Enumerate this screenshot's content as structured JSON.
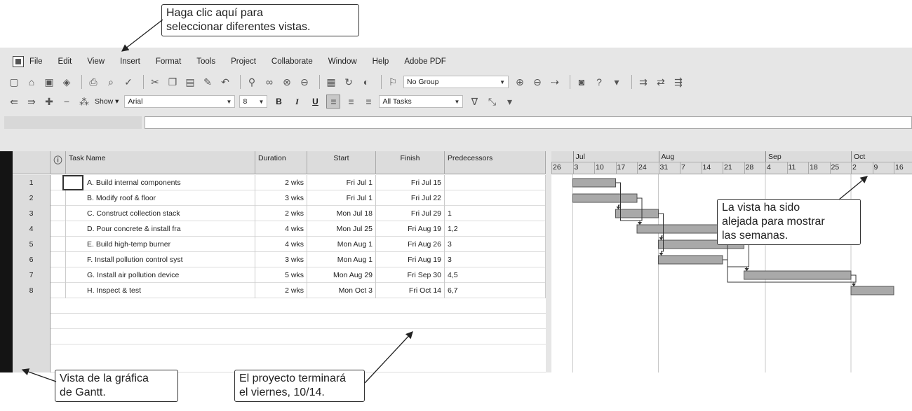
{
  "menubar": {
    "items": [
      "File",
      "Edit",
      "View",
      "Insert",
      "Format",
      "Tools",
      "Project",
      "Collaborate",
      "Window",
      "Help",
      "Adobe PDF"
    ]
  },
  "toolbar": {
    "group_value": "No Group",
    "show_label": "Show",
    "font_value": "Arial",
    "size_value": "8",
    "bold": "B",
    "italic": "I",
    "underline": "U",
    "filter_value": "All Tasks"
  },
  "table": {
    "columns": [
      "Task Name",
      "Duration",
      "Start",
      "Finish",
      "Predecessors"
    ],
    "rows": [
      {
        "id": "1",
        "name": "A. Build internal components",
        "duration": "2 wks",
        "start": "Fri Jul 1",
        "finish": "Fri Jul 15",
        "pred": ""
      },
      {
        "id": "2",
        "name": "B. Modify roof & floor",
        "duration": "3 wks",
        "start": "Fri Jul 1",
        "finish": "Fri Jul 22",
        "pred": ""
      },
      {
        "id": "3",
        "name": "C. Construct collection stack",
        "duration": "2 wks",
        "start": "Mon Jul 18",
        "finish": "Fri Jul 29",
        "pred": "1"
      },
      {
        "id": "4",
        "name": "D. Pour concrete & install fra",
        "duration": "4 wks",
        "start": "Mon Jul 25",
        "finish": "Fri Aug 19",
        "pred": "1,2"
      },
      {
        "id": "5",
        "name": "E. Build high-temp burner",
        "duration": "4 wks",
        "start": "Mon Aug 1",
        "finish": "Fri Aug 26",
        "pred": "3"
      },
      {
        "id": "6",
        "name": "F. Install pollution control syst",
        "duration": "3 wks",
        "start": "Mon Aug 1",
        "finish": "Fri Aug 19",
        "pred": "3"
      },
      {
        "id": "7",
        "name": "G. Install air pollution device",
        "duration": "5 wks",
        "start": "Mon Aug 29",
        "finish": "Fri Sep 30",
        "pred": "4,5"
      },
      {
        "id": "8",
        "name": "H. Inspect & test",
        "duration": "2 wks",
        "start": "Mon Oct 3",
        "finish": "Fri Oct 14",
        "pred": "6,7"
      }
    ]
  },
  "gantt": {
    "months": [
      "Jul",
      "Aug",
      "Sep",
      "Oct"
    ],
    "weeks": [
      "26",
      "3",
      "10",
      "17",
      "24",
      "31",
      "7",
      "14",
      "21",
      "28",
      "4",
      "11",
      "18",
      "25",
      "2",
      "9",
      "16"
    ],
    "tasks": [
      {
        "start_week": 1.0,
        "end_week": 3.0
      },
      {
        "start_week": 1.0,
        "end_week": 4.0
      },
      {
        "start_week": 3.0,
        "end_week": 5.0
      },
      {
        "start_week": 4.0,
        "end_week": 8.0
      },
      {
        "start_week": 5.0,
        "end_week": 9.0
      },
      {
        "start_week": 5.0,
        "end_week": 8.0
      },
      {
        "start_week": 9.0,
        "end_week": 14.0
      },
      {
        "start_week": 14.0,
        "end_week": 16.0
      }
    ],
    "bar_color": "#a9a9a9"
  },
  "callouts": {
    "views": "Haga clic aquí para\nseleccionar diferentes vistas.",
    "zoom": "La vista ha sido\nalejada para mostrar\nlas semanas.",
    "gantt_view": "Vista de la gráfica\nde Gantt.",
    "finish": "El proyecto terminará\nel viernes, 10/14."
  }
}
